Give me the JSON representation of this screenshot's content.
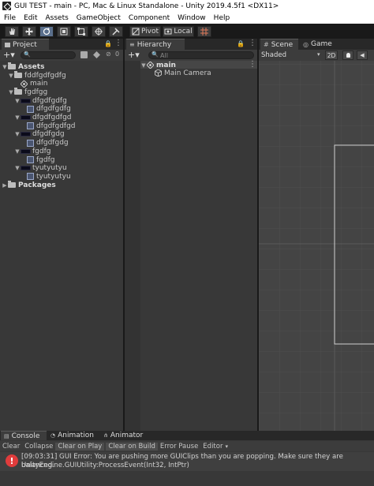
{
  "window": {
    "title": "GUI TEST - main - PC, Mac & Linux Standalone - Unity 2019.4.5f1 <DX11>"
  },
  "menu": [
    "File",
    "Edit",
    "Assets",
    "GameObject",
    "Component",
    "Window",
    "Help"
  ],
  "toolbar": {
    "pivot_label": "Pivot",
    "local_label": "Local"
  },
  "project": {
    "tab_label": "Project",
    "hidden_count": "0",
    "assets_label": "Assets",
    "packages_label": "Packages",
    "rows": [
      {
        "label": "fddfgdfgdfg",
        "indent": 1,
        "kind": "folder"
      },
      {
        "label": "main",
        "indent": 2,
        "kind": "scene"
      },
      {
        "label": "fgdfgg",
        "indent": 1,
        "kind": "folder"
      },
      {
        "label": "dfgdfgdfg",
        "indent": 2,
        "kind": "group"
      },
      {
        "label": "dfgdfgdfg",
        "indent": 3,
        "kind": "prefab"
      },
      {
        "label": "dfgdfgdfgd",
        "indent": 2,
        "kind": "group"
      },
      {
        "label": "dfgdfgdfgd",
        "indent": 3,
        "kind": "prefab"
      },
      {
        "label": "dfgdfgdg",
        "indent": 2,
        "kind": "group"
      },
      {
        "label": "dfgdfgdg",
        "indent": 3,
        "kind": "prefab"
      },
      {
        "label": "fgdfg",
        "indent": 2,
        "kind": "group"
      },
      {
        "label": "fgdfg",
        "indent": 3,
        "kind": "prefab"
      },
      {
        "label": "tyutyutyu",
        "indent": 2,
        "kind": "group"
      },
      {
        "label": "tyutyutyu",
        "indent": 3,
        "kind": "prefab"
      }
    ]
  },
  "hierarchy": {
    "tab_label": "Hierarchy",
    "search_placeholder": "All",
    "scene_label": "main",
    "camera_label": "Main Camera"
  },
  "scene": {
    "tab_scene": "Scene",
    "tab_game": "Game",
    "shading_mode": "Shaded",
    "mode_2d": "2D"
  },
  "console": {
    "tab_console": "Console",
    "tab_animation": "Animation",
    "tab_animator": "Animator",
    "buttons": [
      "Clear",
      "Collapse",
      "Clear on Play",
      "Clear on Build",
      "Error Pause",
      "Editor"
    ],
    "message_line1": "[09:03:31] GUI Error: You are pushing more GUIClips than you are popping. Make sure they are balanced.",
    "message_line2": "UnityEngine.GUIUtility:ProcessEvent(Int32, IntPtr)"
  },
  "colors": {
    "accent": "#5a6f8c",
    "panel": "#383838",
    "error": "#e03c3c"
  }
}
